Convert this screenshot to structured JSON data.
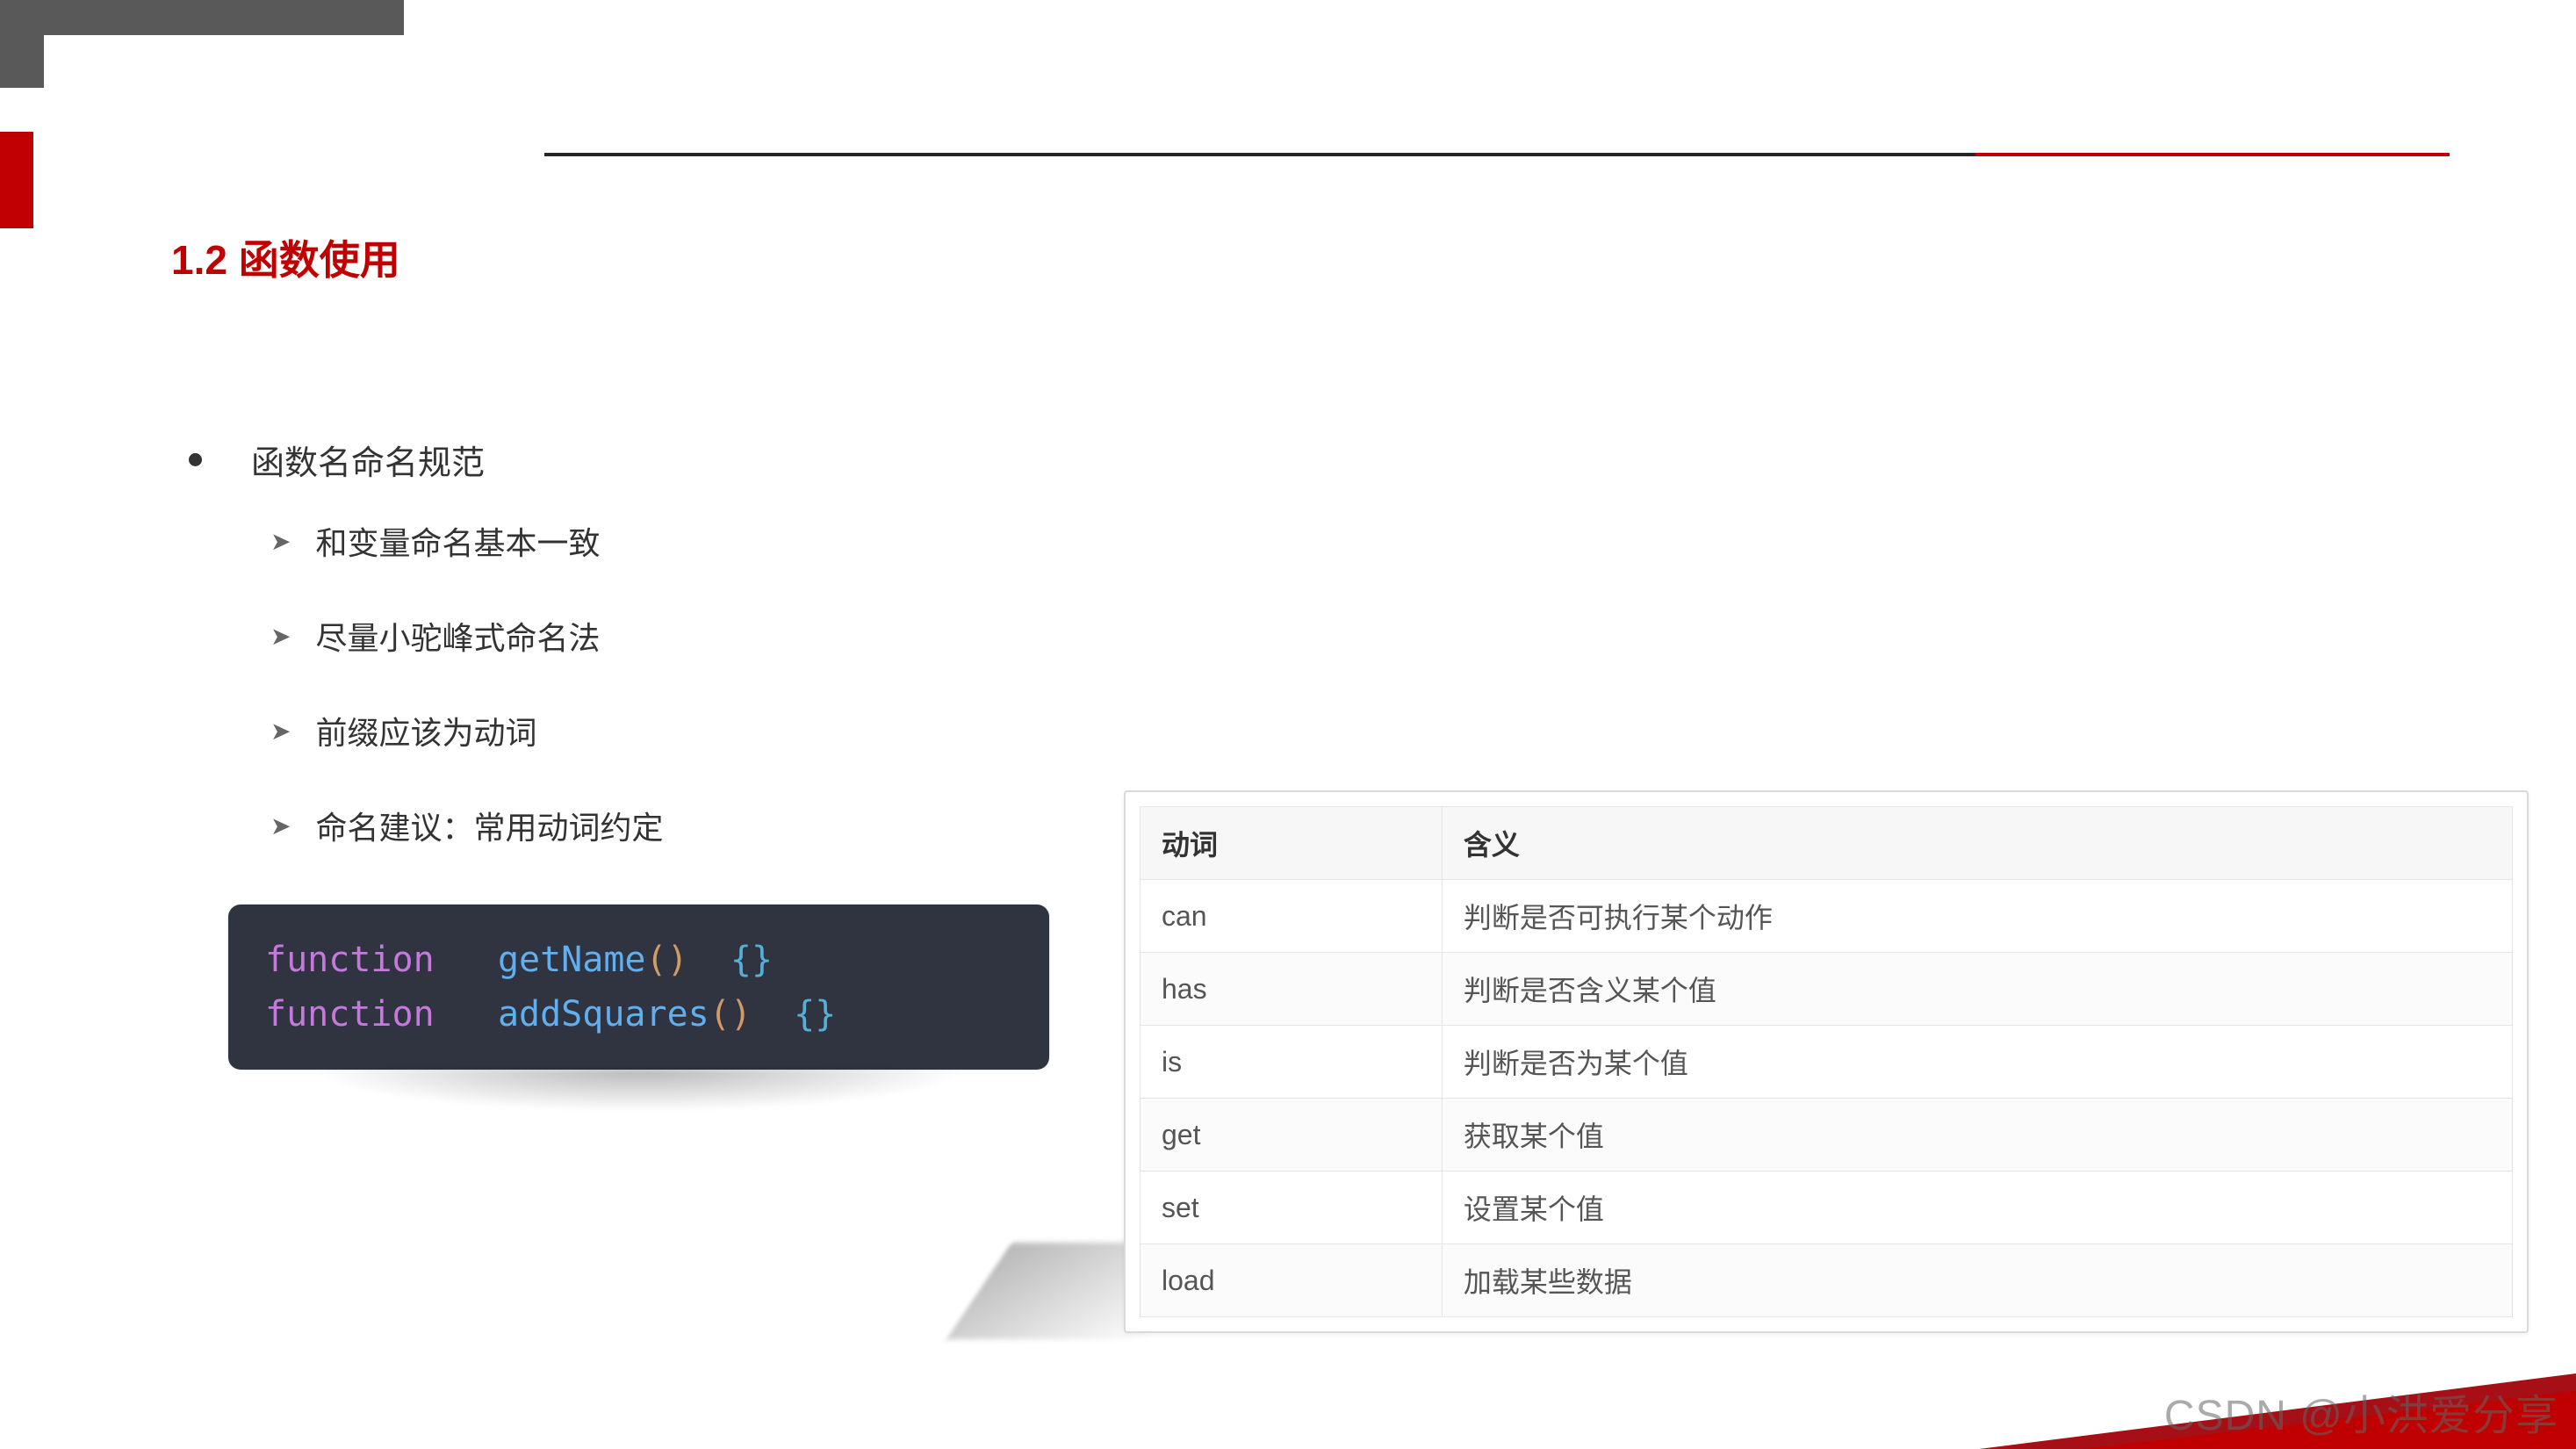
{
  "title": "1.2 函数使用",
  "bullet": "函数名命名规范",
  "subitems": [
    "和变量命名基本一致",
    "尽量小驼峰式命名法",
    "前缀应该为动词",
    "命名建议：常用动词约定"
  ],
  "code": {
    "kw": "function",
    "fn1": "getName",
    "fn2": "addSquares",
    "parens": "()",
    "braces": "{}"
  },
  "table": {
    "headers": {
      "verb": "动词",
      "meaning": "含义"
    },
    "rows": [
      {
        "verb": "can",
        "meaning": "判断是否可执行某个动作"
      },
      {
        "verb": "has",
        "meaning": "判断是否含义某个值"
      },
      {
        "verb": "is",
        "meaning": "判断是否为某个值"
      },
      {
        "verb": "get",
        "meaning": "获取某个值"
      },
      {
        "verb": "set",
        "meaning": "设置某个值"
      },
      {
        "verb": "load",
        "meaning": "加载某些数据"
      }
    ]
  },
  "watermark": "CSDN @小洪爱分享"
}
